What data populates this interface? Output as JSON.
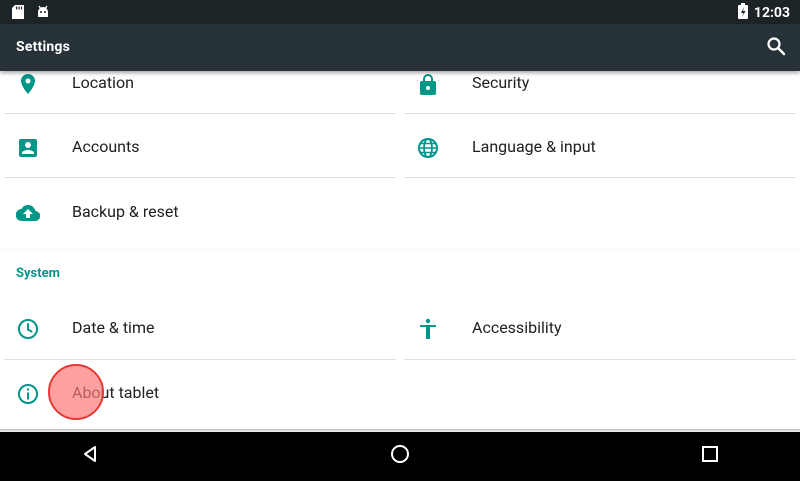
{
  "status_bar": {
    "time": "12:03",
    "left_icons": [
      "sd-card-icon",
      "android-debug-icon"
    ],
    "right_icons": [
      "battery-charging-icon"
    ]
  },
  "toolbar": {
    "title": "Settings",
    "search_icon": "search-icon"
  },
  "personal_items": [
    {
      "label": "Location",
      "icon": "location-pin-icon"
    },
    {
      "label": "Security",
      "icon": "lock-icon"
    },
    {
      "label": "Accounts",
      "icon": "account-box-icon"
    },
    {
      "label": "Language & input",
      "icon": "globe-icon"
    },
    {
      "label": "Backup & reset",
      "icon": "cloud-upload-icon"
    }
  ],
  "system": {
    "header": "System",
    "items": [
      {
        "label": "Date & time",
        "icon": "clock-icon"
      },
      {
        "label": "Accessibility",
        "icon": "accessibility-icon"
      },
      {
        "label": "About tablet",
        "icon": "info-icon"
      }
    ]
  },
  "nav_bar": {
    "back_icon": "back-icon",
    "home_icon": "home-icon",
    "recents_icon": "recents-icon"
  },
  "colors": {
    "accent": "#009688",
    "toolbar": "#263238",
    "status_bar": "#1c2428",
    "touch_indicator": "#e53935"
  }
}
